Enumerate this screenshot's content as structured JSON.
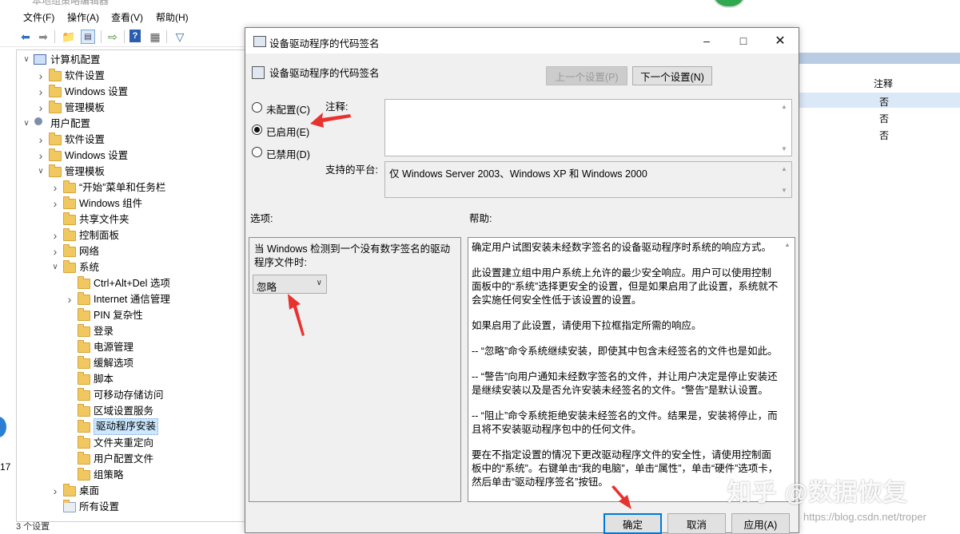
{
  "app": {
    "title": "本地组策略编辑器"
  },
  "menu": [
    "文件(F)",
    "操作(A)",
    "查看(V)",
    "帮助(H)"
  ],
  "toolbar_icons": [
    "back-icon",
    "forward-icon",
    "up-folder-icon",
    "show-hide-tree-icon",
    "export-icon",
    "help-icon",
    "properties-icon",
    "filter-icon"
  ],
  "tree": [
    {
      "label": "计算机配置",
      "level": 0,
      "expander": "open",
      "icon": "computer"
    },
    {
      "label": "软件设置",
      "level": 1,
      "expander": "closed",
      "icon": "folder"
    },
    {
      "label": "Windows 设置",
      "level": 1,
      "expander": "closed",
      "icon": "folder"
    },
    {
      "label": "管理模板",
      "level": 1,
      "expander": "closed",
      "icon": "folder"
    },
    {
      "label": "用户配置",
      "level": 0,
      "expander": "open",
      "icon": "user"
    },
    {
      "label": "软件设置",
      "level": 1,
      "expander": "closed",
      "icon": "folder"
    },
    {
      "label": "Windows 设置",
      "level": 1,
      "expander": "closed",
      "icon": "folder"
    },
    {
      "label": "管理模板",
      "level": 1,
      "expander": "open",
      "icon": "folder"
    },
    {
      "label": "“开始”菜单和任务栏",
      "level": 2,
      "expander": "closed",
      "icon": "folder"
    },
    {
      "label": "Windows 组件",
      "level": 2,
      "expander": "closed",
      "icon": "folder"
    },
    {
      "label": "共享文件夹",
      "level": 2,
      "expander": "none",
      "icon": "folder"
    },
    {
      "label": "控制面板",
      "level": 2,
      "expander": "closed",
      "icon": "folder"
    },
    {
      "label": "网络",
      "level": 2,
      "expander": "closed",
      "icon": "folder"
    },
    {
      "label": "系统",
      "level": 2,
      "expander": "open",
      "icon": "folder"
    },
    {
      "label": "Ctrl+Alt+Del 选项",
      "level": 3,
      "expander": "none",
      "icon": "folder"
    },
    {
      "label": "Internet 通信管理",
      "level": 3,
      "expander": "closed",
      "icon": "folder"
    },
    {
      "label": "PIN 复杂性",
      "level": 3,
      "expander": "none",
      "icon": "folder"
    },
    {
      "label": "登录",
      "level": 3,
      "expander": "none",
      "icon": "folder"
    },
    {
      "label": "电源管理",
      "level": 3,
      "expander": "none",
      "icon": "folder"
    },
    {
      "label": "缓解选项",
      "level": 3,
      "expander": "none",
      "icon": "folder"
    },
    {
      "label": "脚本",
      "level": 3,
      "expander": "none",
      "icon": "folder"
    },
    {
      "label": "可移动存储访问",
      "level": 3,
      "expander": "none",
      "icon": "folder"
    },
    {
      "label": "区域设置服务",
      "level": 3,
      "expander": "none",
      "icon": "folder"
    },
    {
      "label": "驱动程序安装",
      "level": 3,
      "expander": "none",
      "icon": "folder",
      "selected": true
    },
    {
      "label": "文件夹重定向",
      "level": 3,
      "expander": "none",
      "icon": "folder"
    },
    {
      "label": "用户配置文件",
      "level": 3,
      "expander": "none",
      "icon": "folder"
    },
    {
      "label": "组策略",
      "level": 3,
      "expander": "none",
      "icon": "folder"
    },
    {
      "label": "桌面",
      "level": 2,
      "expander": "closed",
      "icon": "folder"
    },
    {
      "label": "所有设置",
      "level": 2,
      "expander": "none",
      "icon": "all-settings"
    }
  ],
  "statusbar": "3 个设置",
  "left_edge_number": "17",
  "right_pane": {
    "column_header": "注释",
    "values": [
      "否",
      "否",
      "否"
    ]
  },
  "dialog": {
    "title": "设备驱动程序的代码签名",
    "header": "设备驱动程序的代码签名",
    "prev_button": "上一个设置(P)",
    "next_button": "下一个设置(N)",
    "radios": [
      {
        "label": "未配置(C)",
        "checked": false
      },
      {
        "label": "已启用(E)",
        "checked": true
      },
      {
        "label": "已禁用(D)",
        "checked": false
      }
    ],
    "comment_label": "注释:",
    "comment_value": "",
    "platform_label": "支持的平台:",
    "platform_value": "仅 Windows Server 2003、Windows XP 和 Windows 2000",
    "options_label": "选项:",
    "help_label": "帮助:",
    "options_text": "当 Windows 检测到一个没有数字签名的驱动程序文件时:",
    "dropdown_value": "忽略",
    "help_paragraphs": [
      "确定用户试图安装未经数字签名的设备驱动程序时系统的响应方式。",
      "此设置建立组中用户系统上允许的最少安全响应。用户可以使用控制面板中的“系统”选择更安全的设置，但是如果启用了此设置，系统就不会实施任何安全性低于该设置的设置。",
      "如果启用了此设置，请使用下拉框指定所需的响应。",
      "-- “忽略”命令系统继续安装，即使其中包含未经签名的文件也是如此。",
      "-- “警告”向用户通知未经数字签名的文件，并让用户决定是停止安装还是继续安装以及是否允许安装未经签名的文件。“警告”是默认设置。",
      "-- “阻止”命令系统拒绝安装未经签名的文件。结果是，安装将停止，而且将不安装驱动程序包中的任何文件。",
      "要在不指定设置的情况下更改驱动程序文件的安全性，请使用控制面板中的“系统”。右键单击“我的电脑”，单击“属性”，单击“硬件”选项卡，然后单击“驱动程序签名”按钮。"
    ],
    "ok_button": "确定",
    "cancel_button": "取消",
    "apply_button": "应用(A)"
  },
  "watermark": "知乎 @数据恢复",
  "watermark_url": "https://blog.csdn.net/troper",
  "colors": {
    "annotation_arrow": "#e8322f",
    "selection": "#cce8ff",
    "primary_border": "#0078d7",
    "folder": "#f1c860"
  }
}
